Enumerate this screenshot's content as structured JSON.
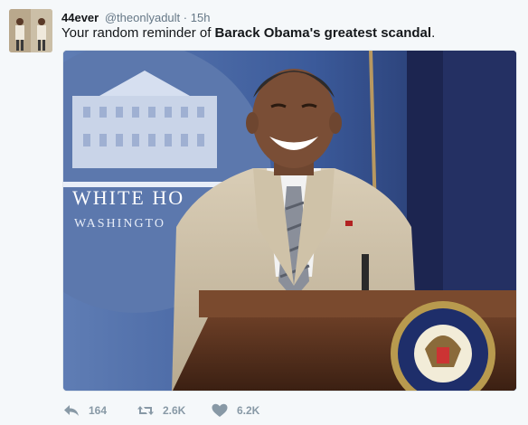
{
  "tweet": {
    "fullname": "44ever",
    "username": "@theonlyadult",
    "separator": "·",
    "time": "15h",
    "text_before": "Your random reminder of ",
    "text_bold": "Barack Obama's greatest scandal",
    "text_after": ".",
    "media": {
      "podium_sign_line1": "WHITE HO",
      "podium_sign_line2": "WASHINGTO"
    },
    "actions": {
      "reply_count": "164",
      "retweet_count": "2.6K",
      "like_count": "6.2K"
    }
  },
  "colors": {
    "action_gray": "#8899a6",
    "name_dark": "#14171a",
    "meta_gray": "#657786",
    "background": "#f5f8fa"
  },
  "icons": [
    "reply-icon",
    "retweet-icon",
    "heart-icon"
  ]
}
